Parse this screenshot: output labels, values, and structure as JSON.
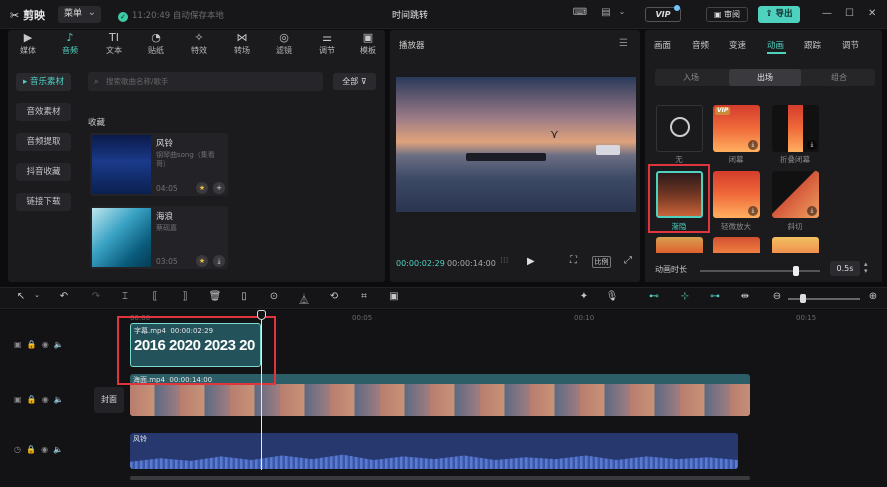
{
  "app": {
    "logo": "剪映",
    "menu_label": "菜单",
    "save_status": "11:20:49 自动保存本地",
    "document_title": "时间跳转",
    "vip_label": "VIP",
    "review_label": "审阅",
    "export_label": "导出"
  },
  "library_tabs": [
    {
      "label": "媒体",
      "icon": "media-icon",
      "glyph": "▶"
    },
    {
      "label": "音频",
      "icon": "audio-icon",
      "glyph": "♪"
    },
    {
      "label": "文本",
      "icon": "text-icon",
      "glyph": "TI"
    },
    {
      "label": "贴纸",
      "icon": "sticker-icon",
      "glyph": "◔"
    },
    {
      "label": "特效",
      "icon": "effects-icon",
      "glyph": "✧"
    },
    {
      "label": "转场",
      "icon": "transition-icon",
      "glyph": "⋈"
    },
    {
      "label": "滤镜",
      "icon": "filter-icon",
      "glyph": "◎"
    },
    {
      "label": "调节",
      "icon": "adjust-icon",
      "glyph": "⚌"
    },
    {
      "label": "模板",
      "icon": "template-icon",
      "glyph": "▣"
    }
  ],
  "audio_sidebar": [
    "音乐素材",
    "音效素材",
    "音频提取",
    "抖音收藏",
    "链接下载"
  ],
  "search": {
    "placeholder": "搜索歌曲名称/歌手"
  },
  "all_button": "全部",
  "favorites_title": "收藏",
  "songs": [
    {
      "title": "风铃",
      "subtitle": "钢琴曲song（集看哥）",
      "duration": "04:05"
    },
    {
      "title": "海浪",
      "subtitle": "蔡砚嘉",
      "duration": "03:05"
    }
  ],
  "player": {
    "title": "播放器",
    "current_time": "00:00:02:29",
    "total_time": "00:00:14:00",
    "ratio_label": "比例"
  },
  "inspector": {
    "tabs": [
      "画面",
      "音频",
      "变速",
      "动画",
      "跟踪",
      "调节"
    ],
    "active_tab": "动画",
    "segments": [
      "入场",
      "出场",
      "组合"
    ],
    "active_segment": "出场",
    "animations": [
      {
        "label": "无"
      },
      {
        "label": "闭幕",
        "vip": "VIP"
      },
      {
        "label": "折叠闭幕"
      },
      {
        "label": "渐隐"
      },
      {
        "label": "轻微放大"
      },
      {
        "label": "斜切"
      }
    ],
    "duration_label": "动画时长",
    "duration_value": "0.5s",
    "duration_fraction": 0.8
  },
  "timeline": {
    "ruler": [
      "00:00",
      "00:05",
      "00:10",
      "00:15"
    ],
    "text_clip": {
      "name": "字幕.mp4",
      "time": "00:00:02:29",
      "content": "2016 2020 2023 20"
    },
    "video_clip": {
      "name": "海面.mp4",
      "time": "00:00:14:00"
    },
    "audio_clip": {
      "name": "风铃"
    },
    "cover_label": "封面"
  }
}
